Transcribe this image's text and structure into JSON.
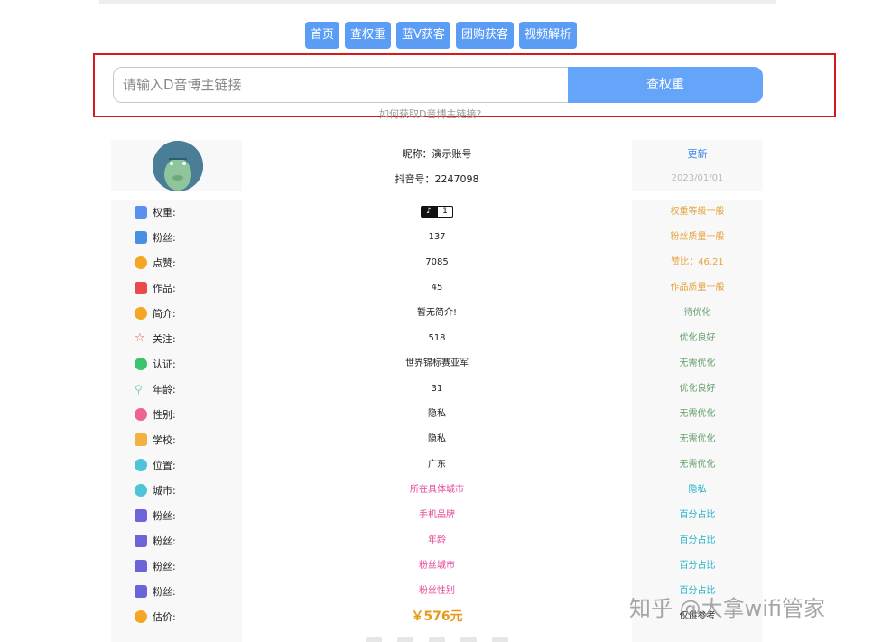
{
  "nav": {
    "items": [
      "首页",
      "查权重",
      "蓝V获客",
      "团购获客",
      "视频解析"
    ]
  },
  "search": {
    "placeholder": "请输入D音博主链接",
    "button_label": "查权重",
    "help_link": "如何获取D音博主链接?"
  },
  "profile": {
    "nickname": "昵称：演示账号",
    "douyin_id": "抖音号：2247098",
    "refresh_label": "更新",
    "update_date": "2023/01/01"
  },
  "rows": [
    {
      "label": "权重:",
      "icon": "hierarchy-icon",
      "icon_color": "#5b8ff0",
      "value": "",
      "badge_logo": "♪",
      "badge_level": "1",
      "note": "权重等级一般",
      "note_style": "orange"
    },
    {
      "label": "粉丝:",
      "icon": "user-card-icon",
      "icon_color": "#4a90e2",
      "value": "137",
      "note": "粉丝质量一般",
      "note_style": "orange"
    },
    {
      "label": "点赞:",
      "icon": "heart-icon",
      "icon_color": "#f5a623",
      "value": "7085",
      "note": "赞比：46.21",
      "note_style": "orange"
    },
    {
      "label": "作品:",
      "icon": "video-icon",
      "icon_color": "#e94b4b",
      "value": "45",
      "note": "作品质量一般",
      "note_style": "orange"
    },
    {
      "label": "简介:",
      "icon": "info-circle-icon",
      "icon_color": "#f5a623",
      "value": "暂无简介!",
      "note": "待优化",
      "note_style": "green"
    },
    {
      "label": "关注:",
      "icon": "star-icon",
      "icon_color": "#e94b4b",
      "value": "518",
      "note": "优化良好",
      "note_style": "green"
    },
    {
      "label": "认证:",
      "icon": "check-circle-icon",
      "icon_color": "#3bc46b",
      "value": "世界锦标赛亚军",
      "note": "无需优化",
      "note_style": "green"
    },
    {
      "label": "年龄:",
      "icon": "person-icon",
      "icon_color": "#8fd1b4",
      "value": "31",
      "note": "优化良好",
      "note_style": "green"
    },
    {
      "label": "性别:",
      "icon": "gender-icon",
      "icon_color": "#f06292",
      "value": "隐私",
      "note": "无需优化",
      "note_style": "green"
    },
    {
      "label": "学校:",
      "icon": "school-icon",
      "icon_color": "#f5b041",
      "value": "隐私",
      "note": "无需优化",
      "note_style": "green"
    },
    {
      "label": "位置:",
      "icon": "location-icon",
      "icon_color": "#4fc3d7",
      "value": "广东",
      "note": "无需优化",
      "note_style": "green"
    },
    {
      "label": "城市:",
      "icon": "city-icon",
      "icon_color": "#4fc3d7",
      "value": "所在具体城市",
      "value_style": "pink",
      "note": "隐私",
      "note_style": "cyan"
    },
    {
      "label": "粉丝:",
      "icon": "fans-chart-icon",
      "icon_color": "#6c63d9",
      "value": "手机品牌",
      "value_style": "pink",
      "note": "百分占比",
      "note_style": "cyan"
    },
    {
      "label": "粉丝:",
      "icon": "fans-chart-icon",
      "icon_color": "#6c63d9",
      "value": "年龄",
      "value_style": "pink",
      "note": "百分占比",
      "note_style": "cyan"
    },
    {
      "label": "粉丝:",
      "icon": "fans-chart-icon",
      "icon_color": "#6c63d9",
      "value": "粉丝城市",
      "value_style": "pink",
      "note": "百分占比",
      "note_style": "cyan"
    },
    {
      "label": "粉丝:",
      "icon": "fans-chart-icon",
      "icon_color": "#6c63d9",
      "value": "粉丝性别",
      "value_style": "pink",
      "note": "百分占比",
      "note_style": "cyan"
    },
    {
      "label": "估价:",
      "icon": "money-bag-icon",
      "icon_color": "#f5a623",
      "value": "￥576元",
      "value_style": "price",
      "note": "仅供参考",
      "note_style": "dark"
    }
  ],
  "watermark": "知乎 @大拿wifi管家"
}
